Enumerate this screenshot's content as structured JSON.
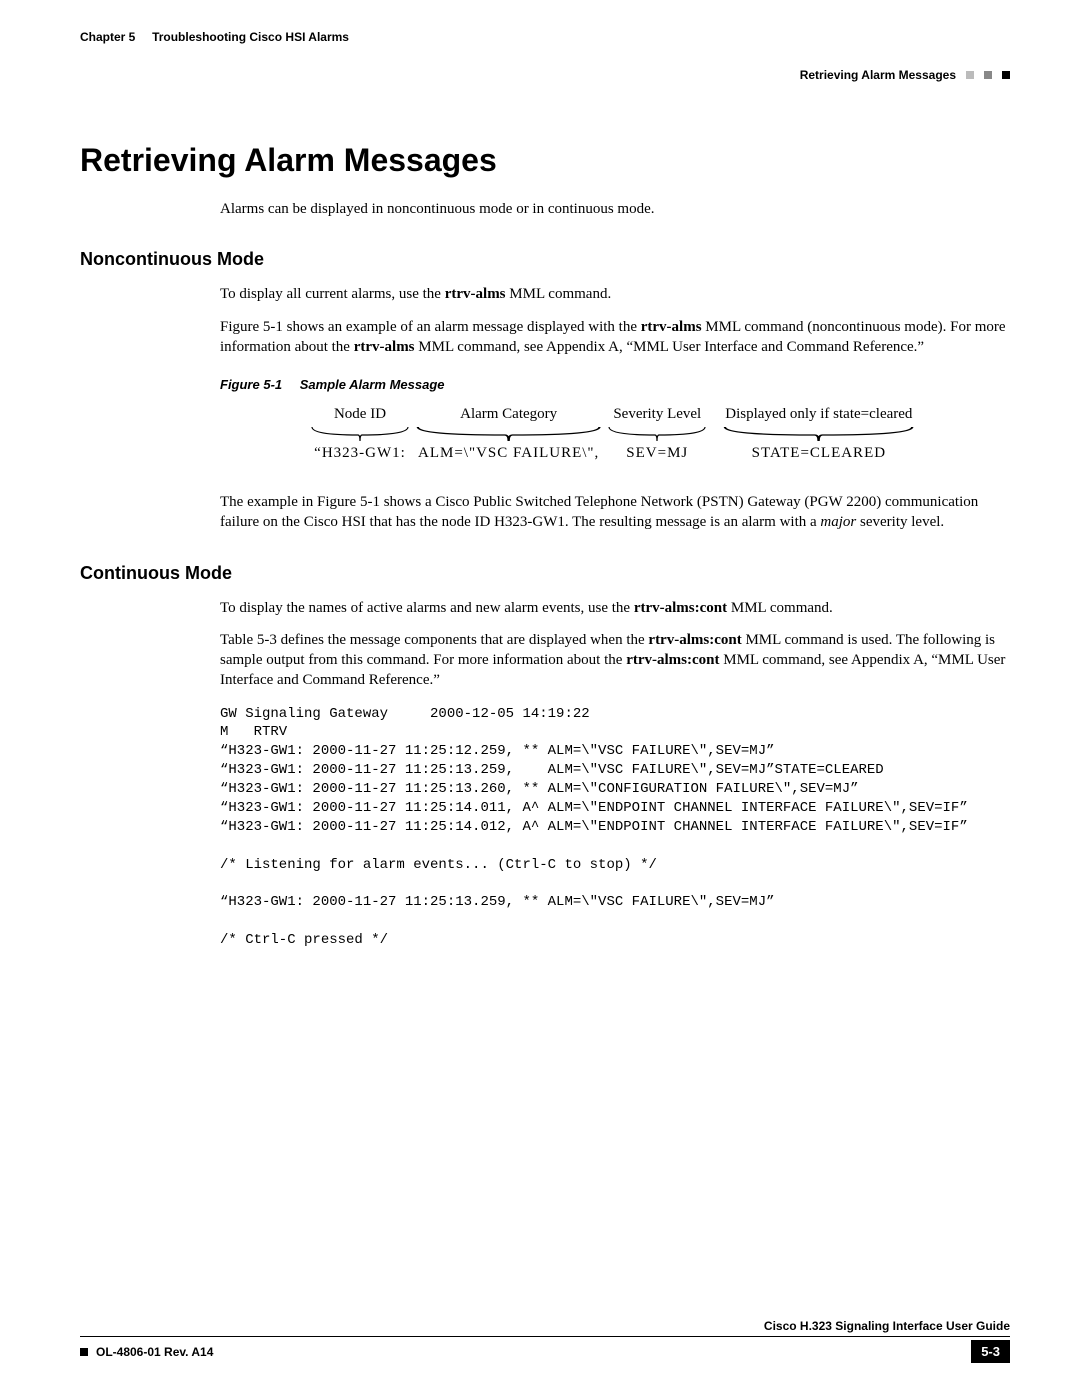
{
  "header": {
    "chapterLabel": "Chapter 5",
    "chapterTitle": "Troubleshooting Cisco HSI Alarms",
    "sectionRight": "Retrieving Alarm Messages"
  },
  "h1": "Retrieving Alarm Messages",
  "intro": "Alarms can be displayed in noncontinuous mode or in continuous mode.",
  "noncont": {
    "heading": "Noncontinuous Mode",
    "p1_pre": "To display all current alarms, use the ",
    "p1_bold": "rtrv-alms",
    "p1_post": " MML command.",
    "p2_a": "Figure 5-1 shows an example of an alarm message displayed with the ",
    "p2_b": "rtrv-alms",
    "p2_c": " MML command (noncontinuous mode). For more information about the ",
    "p2_d": "rtrv-alms",
    "p2_e": " MML command, see Appendix A, “MML User Interface and Command Reference.”",
    "fig": {
      "num": "Figure 5-1",
      "title": "Sample Alarm Message",
      "labels": {
        "node": "Node ID",
        "cat": "Alarm Category",
        "sev": "Severity Level",
        "state": "Displayed only if state=cleared"
      },
      "vals": {
        "node": "“H323-GW1:",
        "cat": "ALM=\\\"VSC FAILURE\\\",",
        "sev": "SEV=MJ",
        "state": "STATE=CLEARED"
      }
    },
    "p3_a": "The example in Figure 5-1 shows a Cisco Public Switched Telephone Network (PSTN) Gateway (PGW 2200) communication failure on the Cisco HSI that has the node ID H323-GW1. The resulting message is an alarm with a ",
    "p3_b": "major",
    "p3_c": " severity level."
  },
  "cont": {
    "heading": "Continuous Mode",
    "p1_a": "To display the names of active alarms and new alarm events, use the ",
    "p1_b": "rtrv-alms:cont",
    "p1_c": " MML command.",
    "p2_a": "Table 5-3 defines the message components that are displayed when the ",
    "p2_b": "rtrv-alms:cont",
    "p2_c": " MML command is used. The following is sample output from this command. For more information about the ",
    "p2_d": "rtrv-alms:cont",
    "p2_e": " MML command, see Appendix A, “MML User Interface and Command Reference.”",
    "code": "GW Signaling Gateway     2000-12-05 14:19:22\nM   RTRV\n“H323-GW1: 2000-11-27 11:25:12.259, ** ALM=\\\"VSC FAILURE\\\",SEV=MJ”\n“H323-GW1: 2000-11-27 11:25:13.259,    ALM=\\\"VSC FAILURE\\\",SEV=MJ”STATE=CLEARED\n“H323-GW1: 2000-11-27 11:25:13.260, ** ALM=\\\"CONFIGURATION FAILURE\\\",SEV=MJ”\n“H323-GW1: 2000-11-27 11:25:14.011, A^ ALM=\\\"ENDPOINT CHANNEL INTERFACE FAILURE\\\",SEV=IF”\n“H323-GW1: 2000-11-27 11:25:14.012, A^ ALM=\\\"ENDPOINT CHANNEL INTERFACE FAILURE\\\",SEV=IF”\n\n/* Listening for alarm events... (Ctrl-C to stop) */\n\n“H323-GW1: 2000-11-27 11:25:13.259, ** ALM=\\\"VSC FAILURE\\\",SEV=MJ”\n\n/* Ctrl-C pressed */"
  },
  "footer": {
    "guide": "Cisco H.323 Signaling Interface User Guide",
    "docnum": "OL-4806-01 Rev. A14",
    "page": "5-3"
  }
}
